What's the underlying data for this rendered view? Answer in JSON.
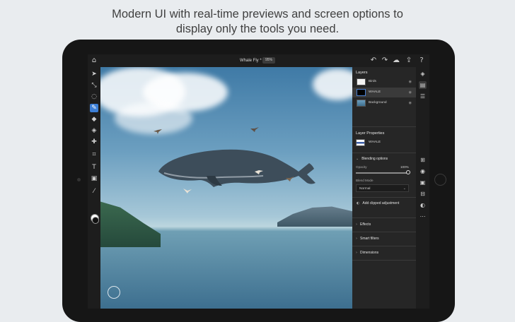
{
  "caption": {
    "line1": "Modern UI with real-time previews and screen options to",
    "line2": "display only the tools you need."
  },
  "app": {
    "doc_title": "Whale Fly *",
    "zoom": "95%",
    "icons": {
      "home": "home-icon",
      "undo": "undo-icon",
      "redo": "redo-icon",
      "cloud": "cloud-icon",
      "share": "share-icon",
      "help": "help-icon"
    }
  },
  "tools": [
    "move-tool-icon",
    "transform-tool-icon",
    "lasso-tool-icon",
    "brush-tool-icon",
    "eraser-tool-icon",
    "fill-tool-icon",
    "healing-tool-icon",
    "crop-tool-icon",
    "type-tool-icon",
    "image-tool-icon",
    "eyedropper-tool-icon"
  ],
  "active_tool": "brush-tool-icon",
  "layers_panel": {
    "title": "Layers",
    "layers": [
      {
        "name": "Birds",
        "selected": false
      },
      {
        "name": "WHALE",
        "selected": true
      },
      {
        "name": "Background",
        "selected": false
      }
    ]
  },
  "layer_properties": {
    "title": "Layer Properties",
    "layer_name": "WHALE",
    "blending_title": "Blending options",
    "opacity_label": "Opacity",
    "opacity_value": "100%",
    "opacity_fraction": 1.0,
    "blend_mode_label": "Blend Mode",
    "blend_mode_value": "Normal",
    "clipped_button": "Add clipped adjustment",
    "sections": [
      "Effects",
      "Smart filters",
      "Dimensions"
    ]
  },
  "colors": {
    "accent": "#3d7fd6",
    "panel": "#262626",
    "toolbar": "#1d1d1d"
  }
}
